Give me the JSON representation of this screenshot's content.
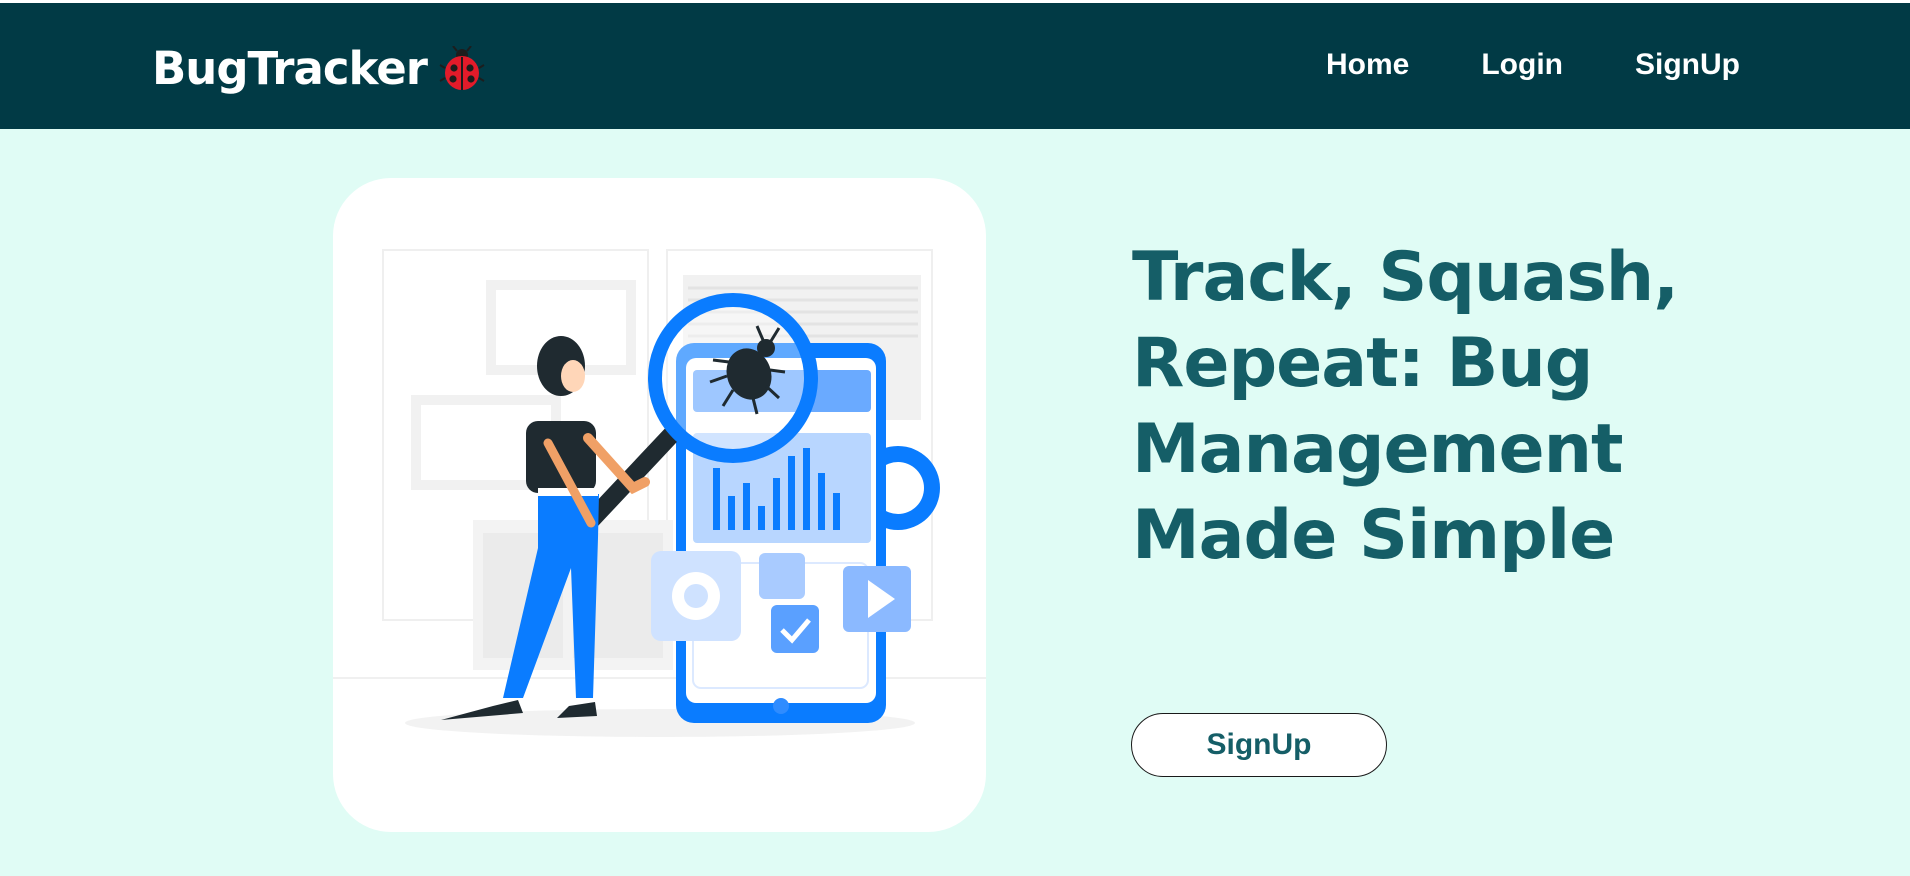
{
  "navbar": {
    "brand": "BugTracker",
    "brand_icon": "ladybug-icon",
    "links": [
      "Home",
      "Login",
      "SignUp"
    ]
  },
  "hero": {
    "illustration": "bug-search-illustration",
    "headline": "Track, Squash, Repeat: Bug Management Made Simple",
    "cta_label": "SignUp"
  },
  "colors": {
    "navbar_bg": "#013A45",
    "page_bg": "#E0FCF5",
    "headline": "#155E67",
    "illustration_accent": "#0A7CFF",
    "ladybug_red": "#E21B2A"
  }
}
